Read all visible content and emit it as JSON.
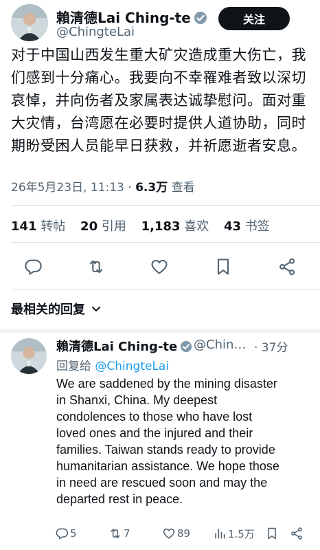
{
  "tweet": {
    "author_name": "賴清德Lai Ching-te",
    "handle": "@ChingteLai",
    "follow_label": "关注",
    "body": "对于中国山西发生重大矿灾造成重大伤亡，我们感到十分痛心。我要向不幸罹难者致以深切哀悼，并向伤者及家属表达诚挚慰问。面对重大灾情，台湾愿在必要时提供人道协助，同时期盼受困人员能早日获救，并祈愿逝者安息。",
    "timestamp": "26年5月23日, 11:13 · ",
    "views_count": "6.3万",
    "views_label": " 查看"
  },
  "stats": [
    {
      "num": "141",
      "label": "转帖"
    },
    {
      "num": "20",
      "label": "引用"
    },
    {
      "num": "1,183",
      "label": "喜欢"
    },
    {
      "num": "43",
      "label": "书签"
    }
  ],
  "actions": {
    "icons": [
      "reply-icon",
      "retweet-icon",
      "like-icon",
      "bookmark-icon",
      "share-icon"
    ]
  },
  "section": {
    "title": "最相关的回复"
  },
  "reply": {
    "author_name": "賴清德Lai Ching-te",
    "handle": "@Chin…",
    "time": "· 37分",
    "reply_prefix": "回复给 ",
    "reply_to": "@ChingteLai",
    "lines": [
      "We are saddened by the mining disaster",
      "in Shanxi, China. My deepest",
      "condolences to those who have lost",
      "loved ones and the injured and their",
      "families. Taiwan stands ready to provide",
      "humanitarian assistance. We hope those",
      "in need are rescued soon and may the",
      "departed rest in peace."
    ],
    "counts": {
      "replies": "5",
      "retweets": "7",
      "likes": "89",
      "views": "1.5万"
    }
  },
  "colors": {
    "text": "#0f1419",
    "secondary": "#536471",
    "accent": "#1d9bf0",
    "verified": "#829aab"
  }
}
